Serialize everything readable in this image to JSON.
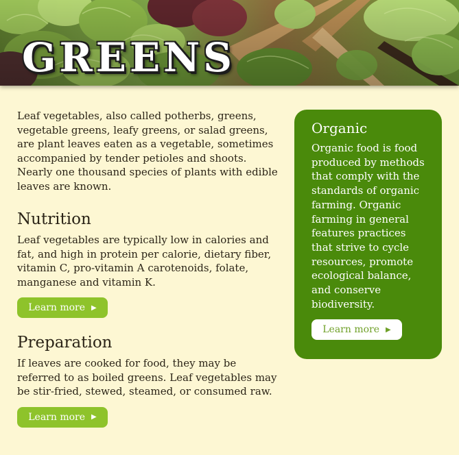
{
  "header": {
    "title": "GREENS"
  },
  "main": {
    "intro": "Leaf vegetables, also called potherbs, greens, vegetable greens, leafy greens, or salad greens, are plant leaves eaten as a vegetable, sometimes accompanied by tender petioles and shoots. Nearly one thousand species of plants with edible leaves are known.",
    "sections": [
      {
        "heading": "Nutrition",
        "text": "Leaf vegetables are typically low in calories and fat, and high in protein per calorie, dietary fiber, vitamin C, pro-vitamin A carotenoids, folate, manganese and vitamin K.",
        "button_label": "Learn more"
      },
      {
        "heading": "Preparation",
        "text": "If leaves are cooked for food, they may be referred to as boiled greens. Leaf vegetables may be stir-fried, stewed, steamed, or consumed raw.",
        "button_label": "Learn more"
      }
    ]
  },
  "aside": {
    "heading": "Organic",
    "text": "Organic food is food produced by methods that comply with the standards of organic farming. Organic farming in general features practices that strive to cycle resources, promote ecological balance, and conserve biodiversity.",
    "button_label": "Learn more"
  },
  "icons": {
    "button_arrow": "arrow-right-icon"
  },
  "colors": {
    "background": "#fdf7d3",
    "aside_background": "#4a8a0b",
    "button_green": "#8ec32b",
    "button_text_on_white": "#6fa028"
  }
}
